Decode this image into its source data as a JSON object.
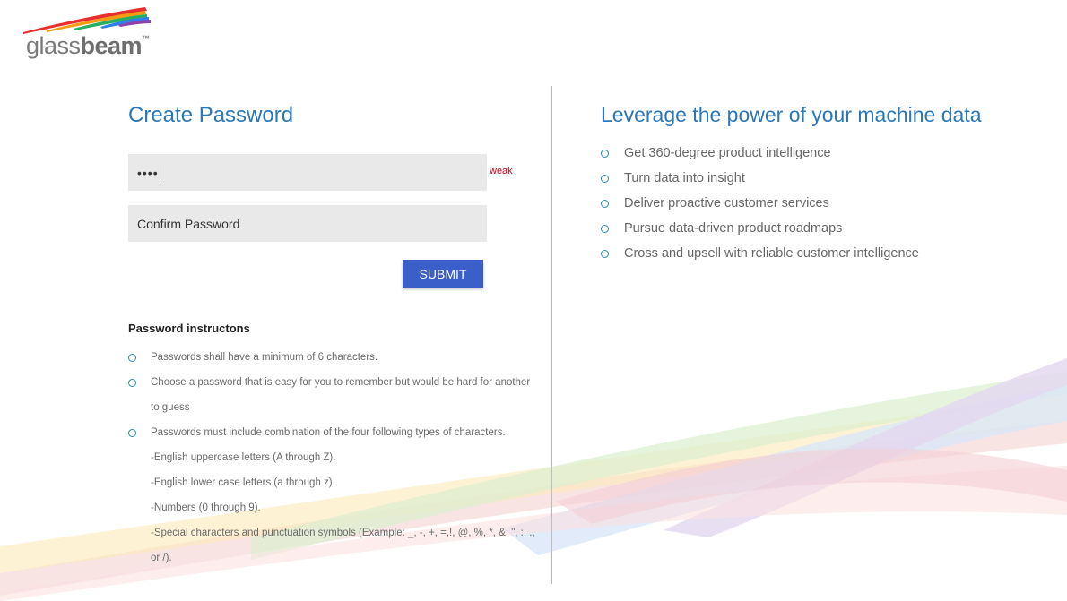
{
  "brand": {
    "logo_text_light": "glass",
    "logo_text_bold": "beam",
    "trademark": "™"
  },
  "form": {
    "title": "Create Password",
    "password_value_masked": "••••",
    "password_strength": "weak",
    "confirm_placeholder": "Confirm Password",
    "submit_label": "SUBMIT"
  },
  "instructions": {
    "heading": "Password instructons",
    "items": [
      {
        "text": "Passwords shall have a minimum of 6 characters.",
        "sub": []
      },
      {
        "text": "Choose a password that is easy for you to remember but would be hard for another to guess",
        "sub": []
      },
      {
        "text": "Passwords must include combination of the four following types of characters.",
        "sub": [
          "-English uppercase letters (A through Z).",
          "-English lower case letters (a through z).",
          "-Numbers (0 through 9).",
          "-Special characters and punctuation symbols (Example: _, -, +, =,!, @, %, *, &, \", :, ., or /)."
        ]
      }
    ]
  },
  "marketing": {
    "tagline": "Leverage the power of your machine data",
    "features": [
      "Get 360-degree product intelligence",
      "Turn data into insight",
      "Deliver proactive customer services",
      "Pursue data-driven product roadmaps",
      "Cross and upsell with reliable customer intelligence"
    ]
  },
  "colors": {
    "accent_blue": "#2a78b8",
    "button_blue": "#3a5fc8",
    "strength_weak": "#d0021b",
    "field_bg": "#e9e9e9"
  }
}
